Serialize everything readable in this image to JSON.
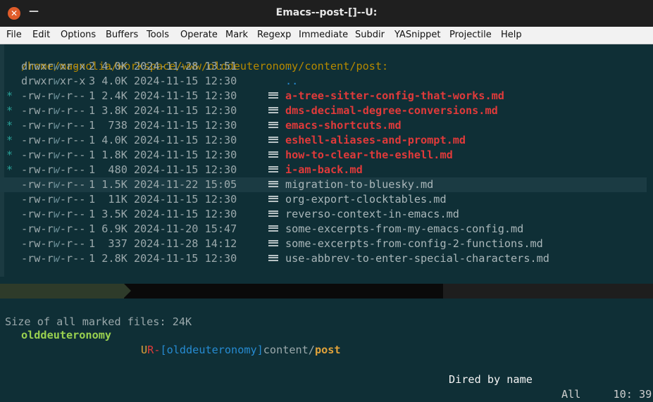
{
  "window": {
    "title": "Emacs--post-[]--U:",
    "close_glyph": "✕",
    "minimize_glyph": "—"
  },
  "menu": [
    "File",
    "Edit",
    "Options",
    "Buffers",
    "Tools",
    "Operate",
    "Mark",
    "Regexp",
    "Immediate",
    "Subdir",
    "YASnippet",
    "Projectile",
    "Help"
  ],
  "dired": {
    "header": "/home/magnolia/workspace/www/olddeuteronomy/content/post:",
    "entries": [
      {
        "mark": "",
        "perm_a": "drwxr",
        "perm_w": "w",
        "perm_b": "xr-x",
        "meta": "2 4.0K 2024-11-28 13:51",
        "name": ".",
        "kind": "dot",
        "icon": false
      },
      {
        "mark": "",
        "perm_a": "drwxr",
        "perm_w": "w",
        "perm_b": "xr-x",
        "meta": "3 4.0K 2024-11-15 12:30",
        "name": "..",
        "kind": "dot",
        "icon": false
      },
      {
        "mark": "*",
        "perm_a": "-rw-r",
        "perm_w": "w",
        "perm_b": "-r--",
        "meta": "1 2.4K 2024-11-15 12:30",
        "name": "a-tree-sitter-config-that-works.md",
        "kind": "marked",
        "icon": true
      },
      {
        "mark": "*",
        "perm_a": "-rw-r",
        "perm_w": "w",
        "perm_b": "-r--",
        "meta": "1 3.8K 2024-11-15 12:30",
        "name": "dms-decimal-degree-conversions.md",
        "kind": "marked",
        "icon": true
      },
      {
        "mark": "*",
        "perm_a": "-rw-r",
        "perm_w": "w",
        "perm_b": "-r--",
        "meta": "1  738 2024-11-15 12:30",
        "name": "emacs-shortcuts.md",
        "kind": "marked",
        "icon": true
      },
      {
        "mark": "*",
        "perm_a": "-rw-r",
        "perm_w": "w",
        "perm_b": "-r--",
        "meta": "1 4.0K 2024-11-15 12:30",
        "name": "eshell-aliases-and-prompt.md",
        "kind": "marked",
        "icon": true
      },
      {
        "mark": "*",
        "perm_a": "-rw-r",
        "perm_w": "w",
        "perm_b": "-r--",
        "meta": "1 1.8K 2024-11-15 12:30",
        "name": "how-to-clear-the-eshell.md",
        "kind": "marked",
        "icon": true
      },
      {
        "mark": "*",
        "perm_a": "-rw-r",
        "perm_w": "w",
        "perm_b": "-r--",
        "meta": "1  480 2024-11-15 12:30",
        "name": "i-am-back.md",
        "kind": "marked",
        "icon": true
      },
      {
        "mark": "",
        "perm_a": "-rw-r",
        "perm_w": "w",
        "perm_b": "-r--",
        "meta": "1 1.5K 2024-11-22 15:05",
        "name": "migration-to-bluesky.md",
        "kind": "current",
        "icon": true
      },
      {
        "mark": "",
        "perm_a": "-rw-r",
        "perm_w": "w",
        "perm_b": "-r--",
        "meta": "1  11K 2024-11-15 12:30",
        "name": "org-export-clocktables.md",
        "kind": "normal",
        "icon": true
      },
      {
        "mark": "",
        "perm_a": "-rw-r",
        "perm_w": "w",
        "perm_b": "-r--",
        "meta": "1 3.5K 2024-11-15 12:30",
        "name": "reverso-context-in-emacs.md",
        "kind": "normal",
        "icon": true
      },
      {
        "mark": "",
        "perm_a": "-rw-r",
        "perm_w": "w",
        "perm_b": "-r--",
        "meta": "1 6.9K 2024-11-20 15:47",
        "name": "some-excerpts-from-my-emacs-config.md",
        "kind": "normal",
        "icon": true
      },
      {
        "mark": "",
        "perm_a": "-rw-r",
        "perm_w": "w",
        "perm_b": "-r--",
        "meta": "1  337 2024-11-28 14:12",
        "name": "some-excerpts-from-config-2-functions.md",
        "kind": "normal",
        "icon": true
      },
      {
        "mark": "",
        "perm_a": "-rw-r",
        "perm_w": "w",
        "perm_b": "-r--",
        "meta": "1 2.8K 2024-11-15 12:30",
        "name": "use-abbrev-to-enter-special-characters.md",
        "kind": "normal",
        "icon": true
      }
    ]
  },
  "modeline": {
    "buffer": "olddeuteronomy",
    "state_u": "U",
    "state_r": "R",
    "sep": "-",
    "project": "[olddeuteronomy]",
    "dir": "content/",
    "leaf": "post",
    "mode": "Dired by name",
    "position": "All",
    "line_col": "10: 39"
  },
  "minibuffer": "Size of all marked files: 24K",
  "colors": {
    "background": "#0f2f36",
    "marked": "#e03a3a",
    "header": "#b58900",
    "mark_star": "#2aa198",
    "dot": "#268bd2",
    "modeline_buffer": "#9ad14f"
  }
}
